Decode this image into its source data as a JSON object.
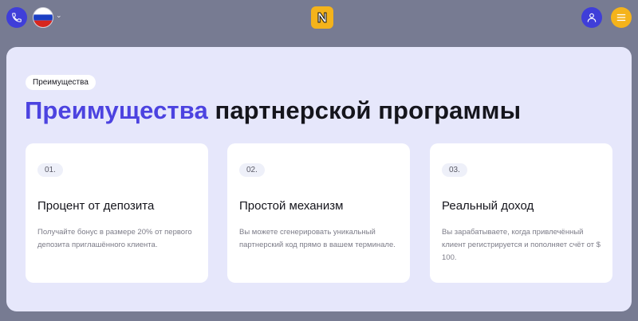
{
  "header": {
    "phone_icon": "phone-icon",
    "flag_icon": "russia-flag-icon",
    "chevron": "⌄",
    "logo_letter": "N",
    "user_icon": "user-icon",
    "menu_icon": "menu-icon",
    "colors": {
      "primary": "#3f3ed9",
      "accent": "#f4b31b",
      "background": "#777b92"
    }
  },
  "section": {
    "tag_label": "Преимущества",
    "heading_accent": "Преимущества",
    "heading_rest": " партнерской программы",
    "cards": [
      {
        "number": "01.",
        "title": "Процент от депозита",
        "text": "Получайте бонус в размере 20% от первого депозита приглашённого клиента."
      },
      {
        "number": "02.",
        "title": "Простой механизм",
        "text": "Вы можете сгенерировать уникальный партнерский код прямо в вашем терминале."
      },
      {
        "number": "03.",
        "title": "Реальный доход",
        "text": "Вы зарабатываете, когда привлечённый клиент регистрируется и пополняет счёт от $ 100."
      }
    ]
  }
}
